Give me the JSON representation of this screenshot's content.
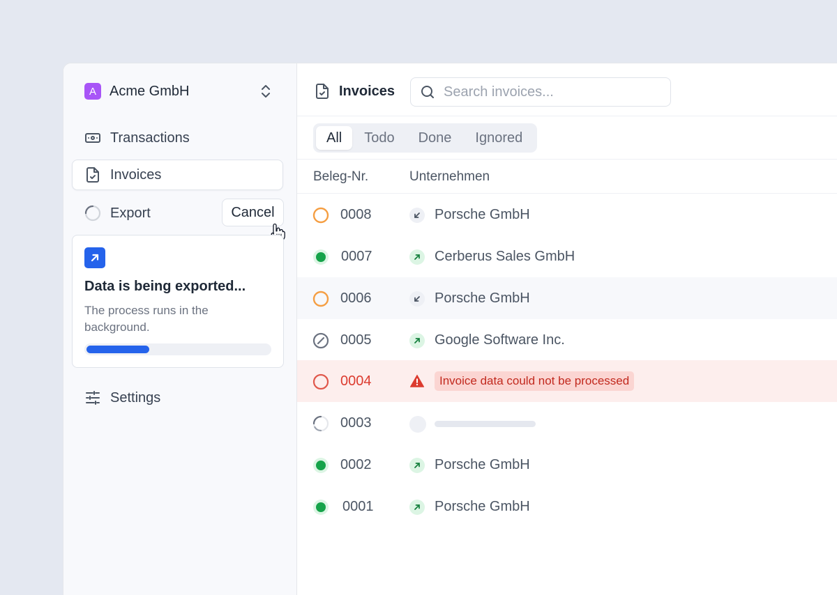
{
  "sidebar": {
    "org": {
      "initial": "A",
      "name": "Acme GmbH",
      "color": "#a855f7"
    },
    "items": [
      {
        "label": "Transactions",
        "icon": "banknote-icon"
      },
      {
        "label": "Invoices",
        "icon": "file-check-icon",
        "active": true
      },
      {
        "label": "Export",
        "icon": "loading-spinner-icon"
      },
      {
        "label": "Settings",
        "icon": "sliders-icon"
      }
    ],
    "cancel_label": "Cancel",
    "export_card": {
      "title": "Data is being exported...",
      "description": "The process runs in the background.",
      "progress_percent": 36,
      "accent": "#2563eb"
    }
  },
  "header": {
    "title": "Invoices",
    "search_placeholder": "Search invoices..."
  },
  "tabs": [
    {
      "label": "All",
      "active": true
    },
    {
      "label": "Todo"
    },
    {
      "label": "Done"
    },
    {
      "label": "Ignored"
    }
  ],
  "table": {
    "columns": [
      "Beleg-Nr.",
      "Unternehmen"
    ],
    "rows": [
      {
        "number": "0008",
        "status": "todo",
        "direction": "incoming",
        "company": "Porsche GmbH"
      },
      {
        "number": "0007",
        "status": "done",
        "direction": "outgoing",
        "company": "Cerberus Sales GmbH"
      },
      {
        "number": "0006",
        "status": "todo",
        "direction": "incoming",
        "company": "Porsche GmbH"
      },
      {
        "number": "0005",
        "status": "ignored",
        "direction": "outgoing",
        "company": "Google Software Inc."
      },
      {
        "number": "0004",
        "status": "error",
        "error": "Invoice data could not be processed"
      },
      {
        "number": "0003",
        "status": "processing"
      },
      {
        "number": "0002",
        "status": "done",
        "direction": "outgoing",
        "company": "Porsche GmbH"
      },
      {
        "number": "0001",
        "status": "done",
        "direction": "outgoing",
        "company": "Porsche GmbH"
      }
    ]
  },
  "colors": {
    "todo": "#f59e42",
    "done": "#16a34a",
    "error": "#e0574b",
    "ignored": "#9ca3af"
  }
}
